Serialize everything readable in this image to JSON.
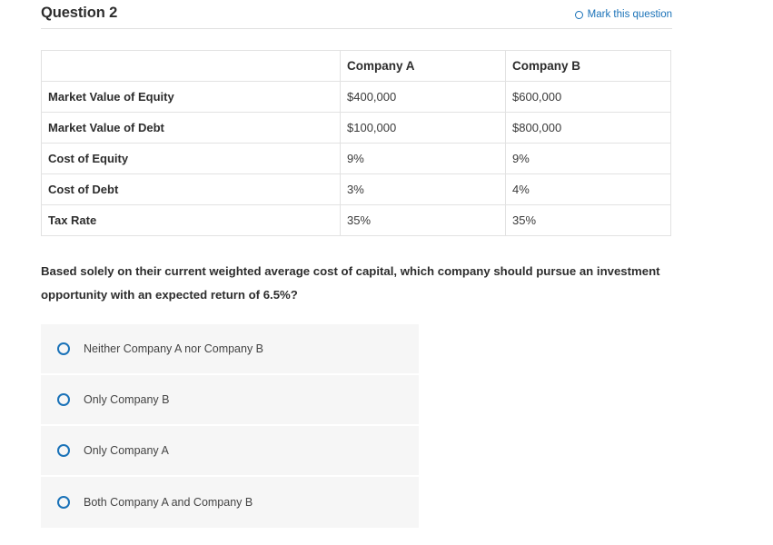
{
  "header": {
    "title": "Question 2",
    "mark_label": "Mark this question",
    "mark_icon": "circle-outline-icon",
    "accent_color": "#1a72b8"
  },
  "table": {
    "columns": [
      "",
      "Company A",
      "Company B"
    ],
    "rows": [
      {
        "label": "Market Value of Equity",
        "company_a": "$400,000",
        "company_b": "$600,000"
      },
      {
        "label": "Market Value of Debt",
        "company_a": "$100,000",
        "company_b": "$800,000"
      },
      {
        "label": "Cost of Equity",
        "company_a": "9%",
        "company_b": "9%"
      },
      {
        "label": "Cost of Debt",
        "company_a": "3%",
        "company_b": "4%"
      },
      {
        "label": "Tax Rate",
        "company_a": "35%",
        "company_b": "35%"
      }
    ]
  },
  "prompt": {
    "text": "Based solely on their current weighted average cost of capital, which company should pursue an investment opportunity with an expected return of 6.5%?"
  },
  "options": [
    {
      "label": "Neither Company A nor Company B",
      "selected": false
    },
    {
      "label": "Only Company B",
      "selected": false
    },
    {
      "label": "Only Company A",
      "selected": false
    },
    {
      "label": "Both Company A and Company B",
      "selected": false
    }
  ]
}
